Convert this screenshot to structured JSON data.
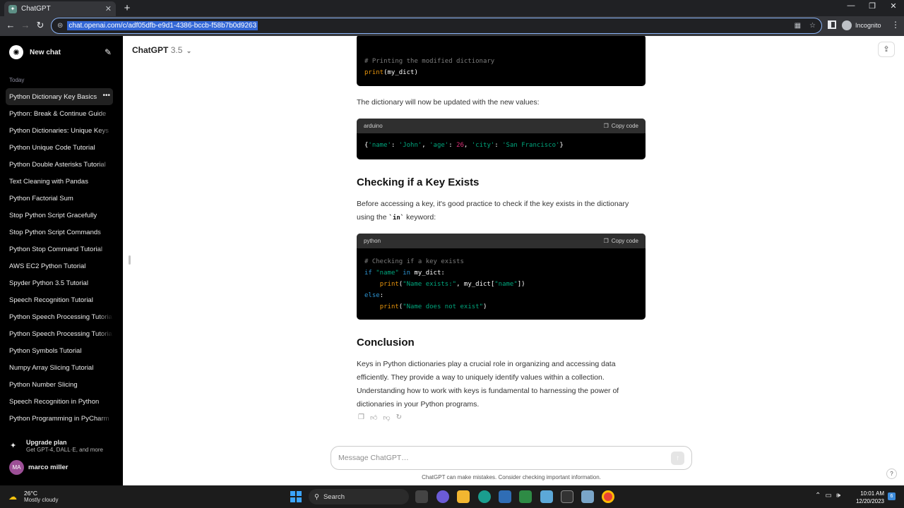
{
  "browser": {
    "tab_title": "ChatGPT",
    "url": "chat.openai.com/c/adf05dfb-e9d1-4386-bccb-f58b7b0d9263",
    "incognito_label": "Incognito"
  },
  "sidebar": {
    "new_chat": "New chat",
    "section_label": "Today",
    "items": [
      {
        "label": "Python Dictionary Key Basics"
      },
      {
        "label": "Python: Break & Continue Guide"
      },
      {
        "label": "Python Dictionaries: Unique Keys"
      },
      {
        "label": "Python Unique Code Tutorial"
      },
      {
        "label": "Python Double Asterisks Tutorial"
      },
      {
        "label": "Text Cleaning with Pandas"
      },
      {
        "label": "Python Factorial Sum"
      },
      {
        "label": "Stop Python Script Gracefully"
      },
      {
        "label": "Stop Python Script Commands"
      },
      {
        "label": "Python Stop Command Tutorial"
      },
      {
        "label": "AWS EC2 Python Tutorial"
      },
      {
        "label": "Spyder Python 3.5 Tutorial"
      },
      {
        "label": "Speech Recognition Tutorial"
      },
      {
        "label": "Python Speech Processing Tutorial"
      },
      {
        "label": "Python Speech Processing Tutorial"
      },
      {
        "label": "Python Symbols Tutorial"
      },
      {
        "label": "Numpy Array Slicing Tutorial"
      },
      {
        "label": "Python Number Slicing"
      },
      {
        "label": "Speech Recognition in Python"
      },
      {
        "label": "Python Programming in PyCharm"
      }
    ],
    "upgrade_title": "Upgrade plan",
    "upgrade_sub": "Get GPT-4, DALL·E, and more",
    "user_initials": "MA",
    "user_name": "marco miller"
  },
  "header": {
    "model": "ChatGPT",
    "version": "3.5"
  },
  "conversation": {
    "code1_tail_comment": "# Printing the modified dictionary",
    "code1_tail_line": "print(my_dict)",
    "para_updated": "The dictionary will now be updated with the new values:",
    "block2": {
      "lang": "arduino",
      "copy_label": "Copy code",
      "line": "{'name': 'John', 'age': 26, 'city': 'San Francisco'}"
    },
    "heading_check": "Checking if a Key Exists",
    "para_check_before": "Before accessing a key, it's good practice to check if the key exists in the dictionary using the",
    "para_check_code": "`in`",
    "para_check_after": "keyword:",
    "block3": {
      "lang": "python",
      "copy_label": "Copy code",
      "comment": "# Checking if a key exists",
      "str_name": "\"name\"",
      "str_exists": "\"Name exists:\"",
      "str_not": "\"Name does not exist\""
    },
    "heading_conclusion": "Conclusion",
    "para_conclusion": "Keys in Python dictionaries play a crucial role in organizing and accessing data efficiently. They provide a way to uniquely identify values within a collection. Understanding how to work with keys is fundamental to harnessing the power of dictionaries in your Python programs."
  },
  "composer": {
    "placeholder": "Message ChatGPT…",
    "disclaimer": "ChatGPT can make mistakes. Consider checking important information.",
    "help": "?"
  },
  "taskbar": {
    "temp": "26°C",
    "weather": "Mostly cloudy",
    "search": "Search",
    "time": "10:01 AM",
    "date": "12/20/2023",
    "notifications": "6"
  }
}
